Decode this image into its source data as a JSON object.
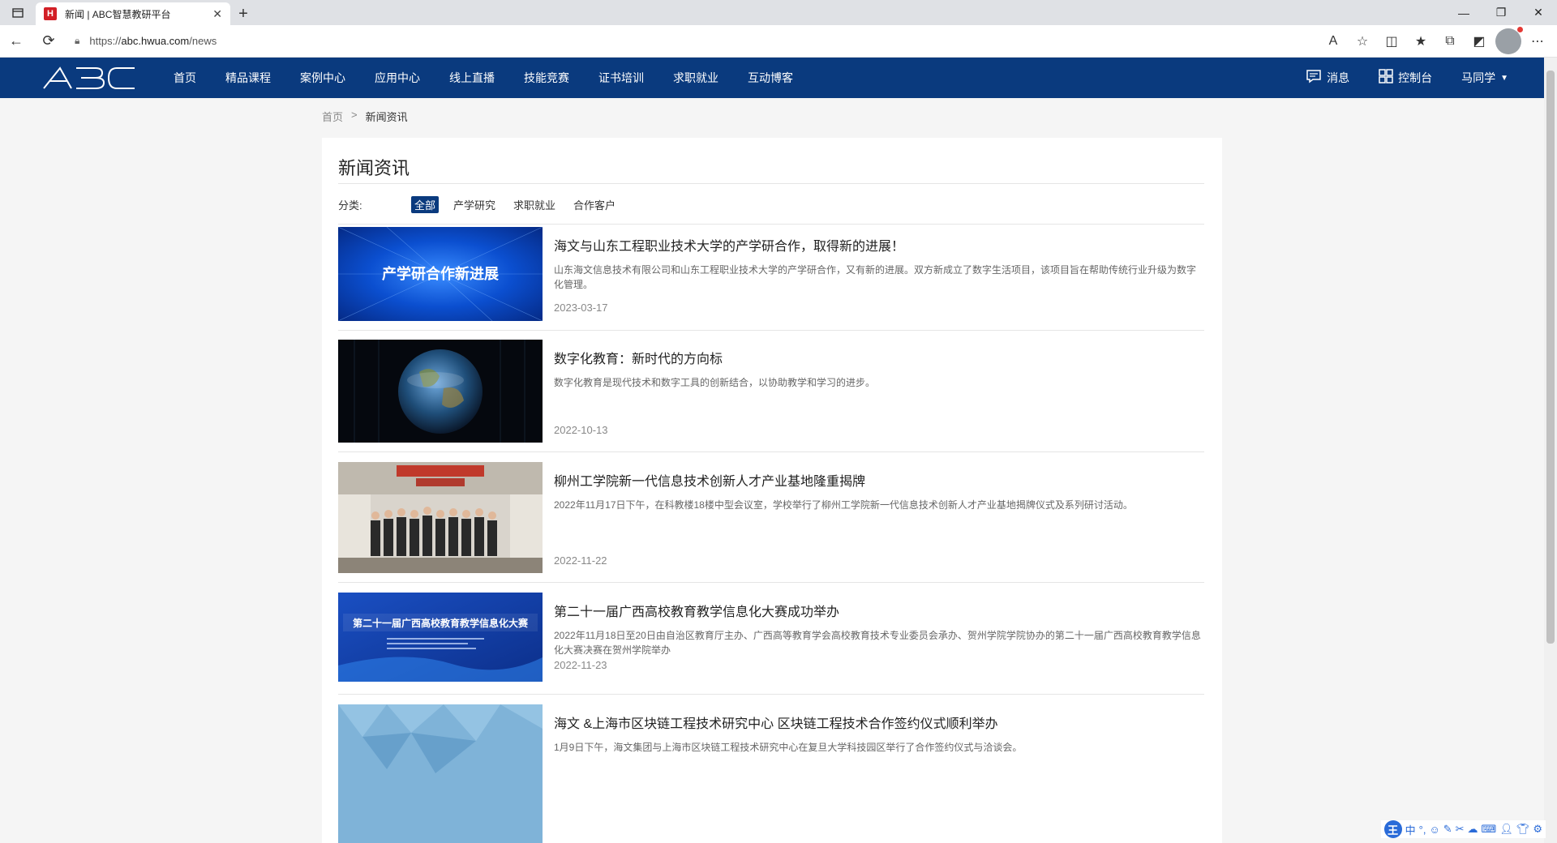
{
  "browser": {
    "tab_title": "新闻 | ABC智慧教研平台",
    "tab_favicon": "H",
    "url_prefix": "https://",
    "url_host": "abc.hwua.com",
    "url_path": "/news"
  },
  "header": {
    "logo_text": "ABC",
    "nav": [
      "首页",
      "精品课程",
      "案例中心",
      "应用中心",
      "线上直播",
      "技能竞赛",
      "证书培训",
      "求职就业",
      "互动博客"
    ],
    "messages_label": "消息",
    "dashboard_label": "控制台",
    "user_name": "马同学"
  },
  "breadcrumb": {
    "home": "首页",
    "separator": ">",
    "current": "新闻资讯"
  },
  "page": {
    "title": "新闻资讯",
    "filter_label": "分类:",
    "filters": [
      "全部",
      "产学研究",
      "求职就业",
      "合作客户"
    ],
    "active_filter": "全部"
  },
  "news": [
    {
      "title": "海文与山东工程职业技术大学的产学研合作，取得新的进展！",
      "summary": "山东海文信息技术有限公司和山东工程职业技术大学的产学研合作，又有新的进展。双方新成立了数字生活项目，该项目旨在帮助传统行业升级为数字化管理。",
      "date": "2023-03-17",
      "image_caption": "产学研合作新进展"
    },
    {
      "title": "数字化教育：新时代的方向标",
      "summary": "数字化教育是现代技术和数字工具的创新结合，以协助教学和学习的进步。",
      "date": "2022-10-13",
      "image_caption": ""
    },
    {
      "title": "柳州工学院新一代信息技术创新人才产业基地隆重揭牌",
      "summary": "2022年11月17日下午，在科教楼18楼中型会议室，学校举行了柳州工学院新一代信息技术创新人才产业基地揭牌仪式及系列研讨活动。",
      "date": "2022-11-22",
      "image_caption": ""
    },
    {
      "title": "第二十一届广西高校教育教学信息化大赛成功举办",
      "summary": "2022年11月18日至20日由自治区教育厅主办、广西高等教育学会高校教育技术专业委员会承办、贺州学院学院协办的第二十一届广西高校教育教学信息化大赛决赛在贺州学院举办",
      "date": "2022-11-23",
      "image_caption": "第二十一届广西高校教育教学信息化大赛"
    },
    {
      "title": "海文 &上海市区块链工程技术研究中心 区块链工程技术合作签约仪式顺利举办",
      "summary": "1月9日下午，海文集团与上海市区块链工程技术研究中心在复旦大学科技园区举行了合作签约仪式与洽谈会。",
      "date": "",
      "image_caption": ""
    }
  ],
  "ime": {
    "logo": "王",
    "mode": "中"
  },
  "colors": {
    "header_bg": "#0a3a7e",
    "active_filter_bg": "#0a3a7e"
  }
}
